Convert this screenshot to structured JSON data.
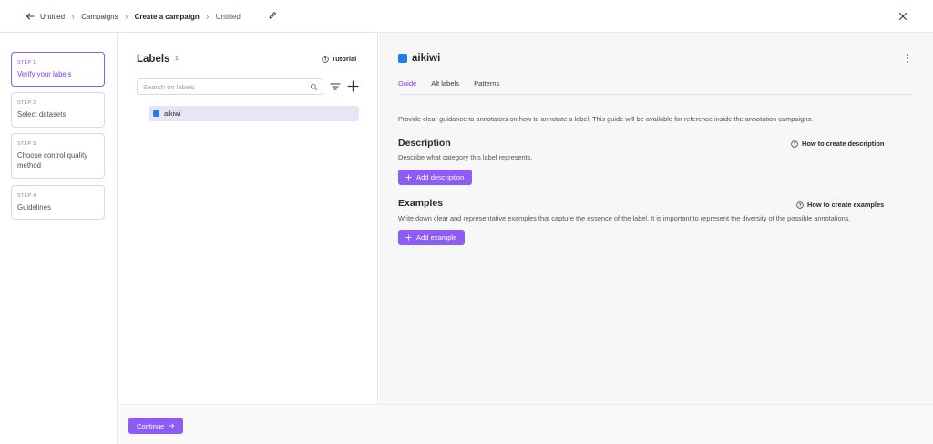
{
  "breadcrumb": {
    "items": [
      "Untitled",
      "Campaigns",
      "Create a campaign",
      "Untitled"
    ]
  },
  "steps": [
    {
      "num": "STEP 1",
      "title": "Verify your labels"
    },
    {
      "num": "STEP 2",
      "title": "Select datasets"
    },
    {
      "num": "STEP 3",
      "title": "Choose control quality method"
    },
    {
      "num": "STEP 4",
      "title": "Guidelines"
    }
  ],
  "labels_panel": {
    "title": "Labels",
    "count": "1",
    "tutorial": "Tutorial",
    "search_placeholder": "Search on labels",
    "items": [
      {
        "name": "aikiwi",
        "color": "#1a7fe6"
      }
    ]
  },
  "detail": {
    "label_name": "aikiwi",
    "label_color": "#1a7fe6",
    "tabs": [
      "Guide",
      "Alt labels",
      "Patterns"
    ],
    "guide_text": "Provide clear guidance to annotators on how to annotate a label. This guide will be available for reference inside the annotation campaigns.",
    "description": {
      "title": "Description",
      "text": "Describe what category this label represents.",
      "howto": "How to create description",
      "button": "Add description"
    },
    "examples": {
      "title": "Examples",
      "text": "Write down clear and representative examples that capture the essence of the label. It is important to represent the diversity of the possible annotations.",
      "howto": "How to create examples",
      "button": "Add example"
    }
  },
  "footer": {
    "continue": "Continue"
  },
  "colors": {
    "accent": "#8b5cf6"
  }
}
